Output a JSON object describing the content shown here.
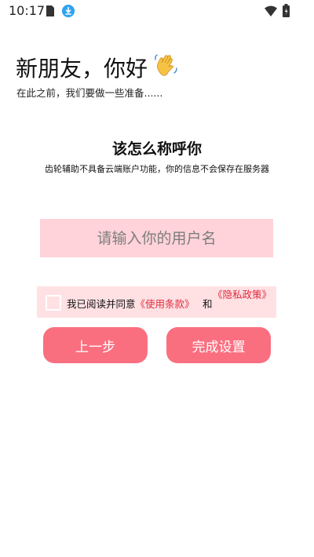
{
  "status_bar": {
    "time": "10:17",
    "icons": [
      "sim-card-icon",
      "download-icon",
      "wifi-icon",
      "battery-icon"
    ],
    "download_color": "#2ea4f2"
  },
  "greeting": {
    "title": "新朋友，你好",
    "emoji": "waving-hand-icon",
    "subtitle": "在此之前，我们要做一些准备......"
  },
  "question": {
    "title": "该怎么称呼你",
    "subtitle": "齿轮辅助不具备云端账户功能，你的信息不会保存在服务器"
  },
  "username_input": {
    "placeholder": "请输入你的用户名",
    "value": ""
  },
  "agreement": {
    "checked": false,
    "prefix": "我已阅读并同意",
    "terms_link": "《使用条款》",
    "and": "和",
    "privacy_link": "《隐私政策》"
  },
  "buttons": {
    "back": "上一步",
    "finish": "完成设置"
  },
  "colors": {
    "accent": "#fa6f80",
    "input_bg": "#ffd3d9",
    "agreement_bg": "#ffe1e4",
    "link": "#e02a3a"
  }
}
